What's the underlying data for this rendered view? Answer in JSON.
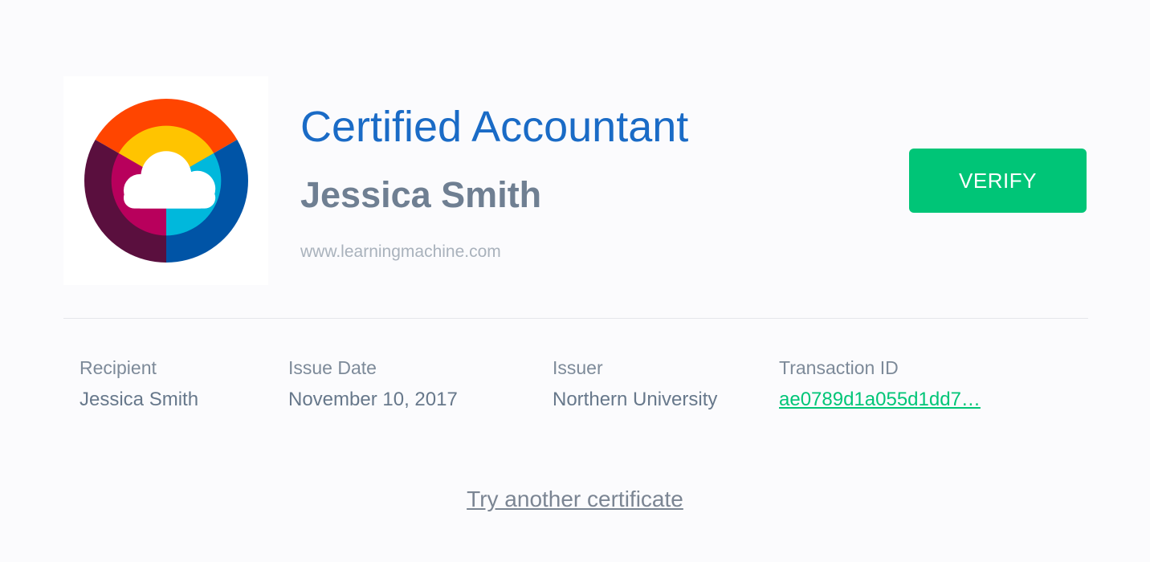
{
  "certificate": {
    "title": "Certified Accountant",
    "recipient_name": "Jessica Smith",
    "issuer_url": "www.learningmachine.com",
    "logo": {
      "icon": "cloud-rainbow-logo-icon",
      "colors": {
        "outer_top": "#ff4500",
        "outer_left": "#5a0f3e",
        "outer_right": "#0054a6",
        "inner_top": "#ffc400",
        "inner_left": "#b8005c",
        "inner_right": "#00b8dc",
        "cloud": "#ffffff"
      }
    }
  },
  "actions": {
    "verify_label": "VERIFY",
    "try_another_label": "Try another certificate"
  },
  "details": {
    "recipient": {
      "label": "Recipient",
      "value": "Jessica Smith"
    },
    "issue_date": {
      "label": "Issue Date",
      "value": "November 10, 2017"
    },
    "issuer": {
      "label": "Issuer",
      "value": "Northern University"
    },
    "transaction_id": {
      "label": "Transaction ID",
      "value": "ae0789d1a055d1dd7…"
    }
  },
  "theme": {
    "title_color": "#1a6bc6",
    "accent_green": "#00c577",
    "text_gray": "#6f7f92",
    "background": "#fbfbfd"
  }
}
